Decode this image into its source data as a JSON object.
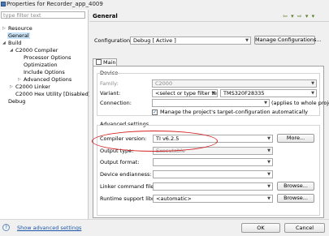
{
  "window": {
    "title": "Properties for Recorder_app_4009"
  },
  "filter": {
    "placeholder": "type filter text"
  },
  "tree": [
    {
      "label": "Resource",
      "arrow": "▷"
    },
    {
      "label": "General",
      "arrow": ""
    },
    {
      "label": "Build",
      "arrow": "◢"
    },
    {
      "label": "C2000 Compiler",
      "arrow": "◢"
    },
    {
      "label": "Processor Options",
      "arrow": ""
    },
    {
      "label": "Optimization",
      "arrow": ""
    },
    {
      "label": "Include Options",
      "arrow": ""
    },
    {
      "label": "Advanced Options",
      "arrow": "▷"
    },
    {
      "label": "C2000 Linker",
      "arrow": "▷"
    },
    {
      "label": "C2000 Hex Utility  [Disabled]",
      "arrow": ""
    },
    {
      "label": "Debug",
      "arrow": ""
    }
  ],
  "header": {
    "title": "General",
    "nav": "⇦ ▾ ⇨ ▾ ▾"
  },
  "configuration": {
    "label": "Configuration:",
    "value": "Debug  [ Active ]",
    "manage_label": "Manage Configurations..."
  },
  "tabs": [
    {
      "label": "Main"
    }
  ],
  "device": {
    "section_label": "Device",
    "family_label": "Family:",
    "family_value": "C2000",
    "variant_label": "Variant:",
    "variant_filter": "<select or type filter text>",
    "variant_value": "TMS320F28335",
    "connection_label": "Connection:",
    "connection_value": "",
    "connection_note": "(applies to whole project)",
    "manage_target_label": "Manage the project's target-configuration automatically",
    "manage_target_checked": true
  },
  "advanced": {
    "section_label": "Advanced settings",
    "compiler_label": "Compiler version:",
    "compiler_value": "TI v6.2.5",
    "more_label": "More...",
    "output_type_label": "Output type:",
    "output_type_value": "Executable",
    "output_format_label": "Output format:",
    "output_format_value": "",
    "endianness_label": "Device endianness:",
    "endianness_value": "",
    "linker_label": "Linker command file:",
    "linker_value": "",
    "browse1_label": "Browse...",
    "runtime_label": "Runtime support library:",
    "runtime_value": "<automatic>",
    "browse2_label": "Browse..."
  },
  "footer": {
    "help": "?",
    "show_advanced": "Show advanced settings",
    "ok": "OK",
    "cancel": "Cancel"
  },
  "colors": {
    "highlight_ellipse": "#d42020",
    "selection": "#cce4f7",
    "link": "#1a55a8"
  }
}
